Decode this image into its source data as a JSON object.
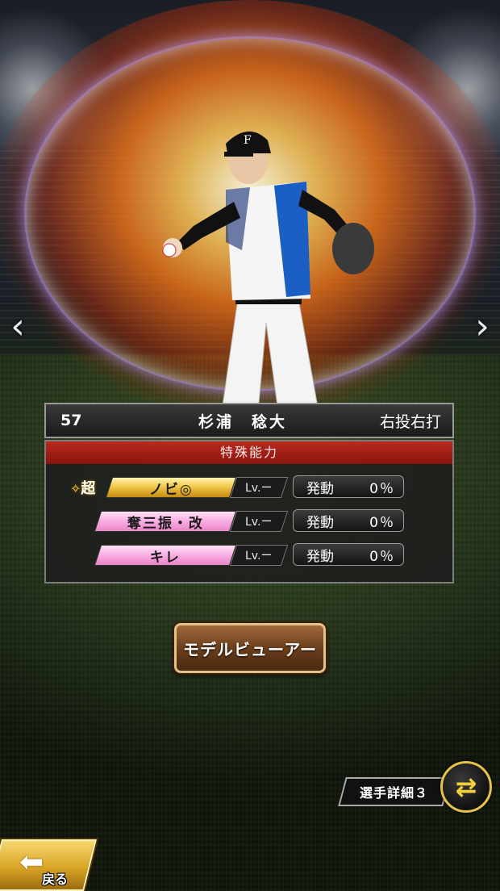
{
  "player": {
    "number": "57",
    "name": "杉浦　稔大",
    "throw_bat": "右投右打"
  },
  "special_abilities": {
    "header": "特殊能力",
    "items": [
      {
        "super_prefix": "超",
        "name": "ノビ◎",
        "level": "Lv.ー",
        "trigger_label": "発動",
        "trigger_pct": "0％",
        "style": "gold"
      },
      {
        "name": "奪三振・改",
        "level": "Lv.ー",
        "trigger_label": "発動",
        "trigger_pct": "0％",
        "style": "pink"
      },
      {
        "name": "キレ",
        "level": "Lv.ー",
        "trigger_label": "発動",
        "trigger_pct": "0％",
        "style": "pink"
      }
    ]
  },
  "buttons": {
    "model_viewer": "モデルビューアー",
    "player_detail": "選手詳細３",
    "back": "戻る"
  },
  "nav": {
    "prev": "‹",
    "next": "›"
  },
  "colors": {
    "header_red": "#b92a1e",
    "gold_tag": "#f1c94b",
    "pink_tag": "#f7a8df",
    "button_brown": "#6b3f1c",
    "accent_gold": "#e5c24a"
  },
  "icons": {
    "swap": "swap-arrows-icon",
    "back": "back-arrow-icon",
    "super": "sparkle-icon"
  }
}
